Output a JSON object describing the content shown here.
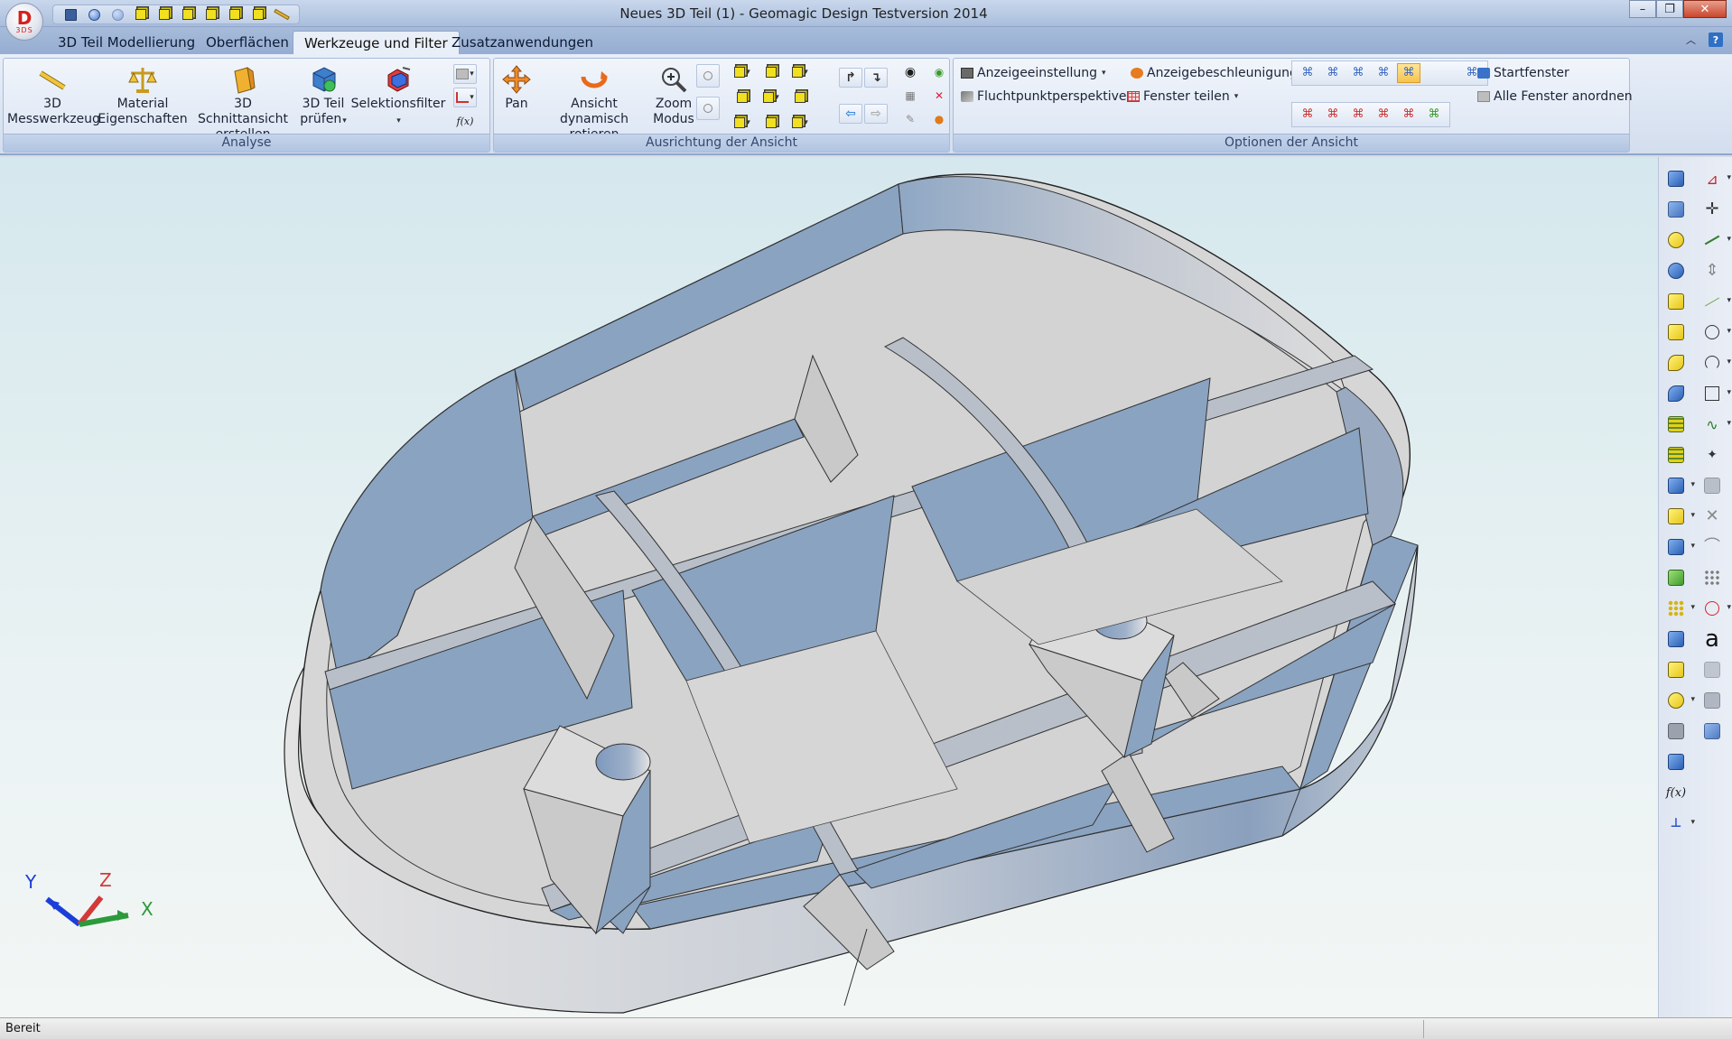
{
  "window": {
    "title": "Neues 3D Teil (1) - Geomagic Design Testversion 2014",
    "logo_letter": "D",
    "logo_sub": "3DS"
  },
  "tabs": [
    {
      "label": "3D Teil Modellierung"
    },
    {
      "label": "Oberflächen"
    },
    {
      "label": "Werkzeuge und Filter",
      "active": true
    },
    {
      "label": "Zusatzanwendungen"
    }
  ],
  "ribbon": {
    "analyse": {
      "label": "Analyse",
      "buttons": [
        {
          "line1": "3D",
          "line2": "Messwerkzeug",
          "icon": "ruler-icon"
        },
        {
          "line1": "Material",
          "line2": "Eigenschaften",
          "icon": "scales-icon"
        },
        {
          "line1": "3D Schnittansicht",
          "line2": "erstellen",
          "icon": "section-view-icon"
        },
        {
          "line1": "3D Teil",
          "line2": "prüfen",
          "icon": "check-part-icon"
        },
        {
          "line1": "Selektionsfilter",
          "line2": "",
          "icon": "selection-filter-icon"
        }
      ]
    },
    "ausrichtung": {
      "label": "Ausrichtung der Ansicht",
      "buttons": [
        {
          "line1": "Pan",
          "line2": "",
          "icon": "pan-icon"
        },
        {
          "line1": "Ansicht dynamisch",
          "line2": "rotieren",
          "icon": "rotate-icon"
        },
        {
          "line1": "Zoom",
          "line2": "Modus",
          "icon": "zoom-icon"
        }
      ]
    },
    "optionen": {
      "label": "Optionen der Ansicht",
      "anzeigeeinstellung": "Anzeigeeinstellung",
      "anzeigebeschleunigung": "Anzeigebeschleunigung",
      "fluchtpunkt": "Fluchtpunktperspektive",
      "fenster_teilen": "Fenster teilen",
      "startfenster": "Startfenster",
      "alle_fenster": "Alle Fenster anordnen"
    },
    "fx_label": "f(x)"
  },
  "axes": {
    "x": "X",
    "y": "Y",
    "z": "Z"
  },
  "right_toolbar": {
    "fx_label": "f(x)",
    "text_tool": "a"
  },
  "status": {
    "text": "Bereit"
  },
  "colors": {
    "part_blue": "#8aa3c0",
    "part_gray": "#d4d4d4",
    "accent": "#f0c43c"
  }
}
